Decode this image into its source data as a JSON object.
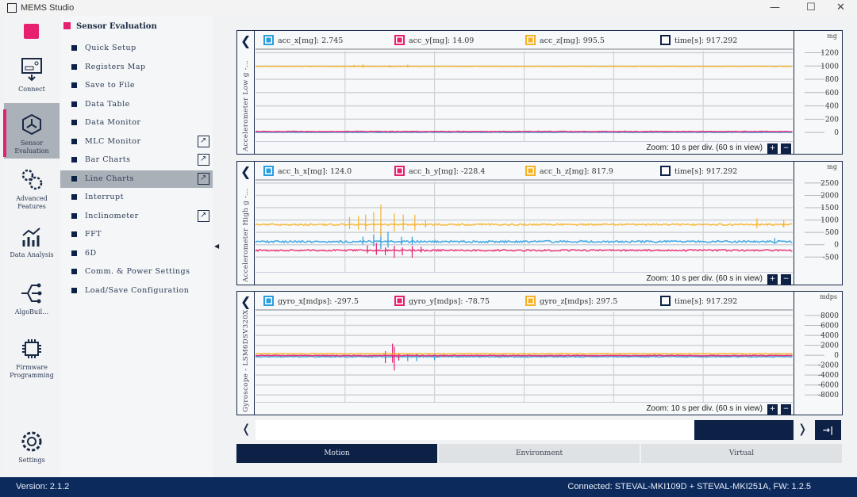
{
  "window": {
    "title": "MEMS Studio",
    "minimize": "—",
    "maximize": "☐",
    "close": "✕"
  },
  "rail": {
    "items": [
      {
        "label": "Connect",
        "icon": "connect-board-icon"
      },
      {
        "label": "Sensor Evaluation",
        "icon": "sensor-cube-icon",
        "selected": true
      },
      {
        "label": "Advanced Features",
        "icon": "gears-icon"
      },
      {
        "label": "Data Analysis",
        "icon": "analysis-chart-icon"
      },
      {
        "label": "AlgoBuil…",
        "icon": "algo-graph-icon"
      },
      {
        "label": "Firmware Programming",
        "icon": "chip-icon"
      },
      {
        "label": "Settings",
        "icon": "settings-gear-icon"
      }
    ]
  },
  "menu": {
    "header": "Sensor Evaluation",
    "items": [
      {
        "label": "Quick Setup"
      },
      {
        "label": "Registers Map"
      },
      {
        "label": "Save to File"
      },
      {
        "label": "Data Table"
      },
      {
        "label": "Data Monitor"
      },
      {
        "label": "MLC Monitor",
        "external": true
      },
      {
        "label": "Bar Charts",
        "external": true
      },
      {
        "label": "Line Charts",
        "external": true,
        "selected": true
      },
      {
        "label": "Interrupt"
      },
      {
        "label": "Inclinometer",
        "external": true
      },
      {
        "label": "FFT"
      },
      {
        "label": "6D"
      },
      {
        "label": "Comm. & Power Settings"
      },
      {
        "label": "Load/Save Configuration"
      }
    ],
    "collapse": "◀"
  },
  "colors": {
    "x": "#2a9de0",
    "y": "#e6206e",
    "z": "#f6b126",
    "time": "#0d2147",
    "accent": "#0d2147"
  },
  "chart_data": [
    {
      "type": "line",
      "title": "Accelerometer Low g -…",
      "unit": "mg",
      "ylim": [
        -130,
        1230
      ],
      "yticks": [
        0,
        200,
        400,
        600,
        800,
        1000,
        1200
      ],
      "xlim": [
        0,
        60
      ],
      "x_divisions": 6,
      "legend": [
        {
          "label": "acc_x[mg]: 2.745"
        },
        {
          "label": "acc_y[mg]: 14.09"
        },
        {
          "label": "acc_z[mg]: 995.5"
        },
        {
          "label": "time[s]: 917.292"
        }
      ],
      "series": [
        {
          "name": "acc_x",
          "color": "#2a9de0",
          "base": 3,
          "noise": 4,
          "spikes": [
            [
              15,
              -15
            ]
          ]
        },
        {
          "name": "acc_y",
          "color": "#e6206e",
          "base": 14,
          "noise": 4,
          "spikes": [
            [
              14.5,
              10
            ],
            [
              17,
              8
            ]
          ]
        },
        {
          "name": "acc_z",
          "color": "#f6b126",
          "base": 995,
          "noise": 3,
          "spikes": [
            [
              9,
              15
            ],
            [
              11,
              20
            ],
            [
              12,
              30
            ],
            [
              15,
              20
            ],
            [
              17,
              25
            ]
          ]
        }
      ],
      "zoom_text": "Zoom: 10 s per div. (60 s in view)"
    },
    {
      "type": "line",
      "title": "Accelerometer High g -…",
      "unit": "mg",
      "ylim": [
        -1100,
        2560
      ],
      "yticks": [
        -500,
        0,
        500,
        1000,
        1500,
        2000,
        2500
      ],
      "xlim": [
        0,
        60
      ],
      "x_divisions": 6,
      "legend": [
        {
          "label": "acc_h_x[mg]: 124.0"
        },
        {
          "label": "acc_h_y[mg]: -228.4"
        },
        {
          "label": "acc_h_z[mg]: 817.9"
        },
        {
          "label": "time[s]: 917.292"
        }
      ],
      "series": [
        {
          "name": "acc_h_x",
          "color": "#2a9de0",
          "base": 124,
          "noise": 40,
          "spikes": [
            [
              12,
              200
            ],
            [
              13.2,
              300
            ],
            [
              14,
              500
            ],
            [
              14.8,
              400
            ],
            [
              16.3,
              200
            ],
            [
              17.5,
              200
            ],
            [
              58,
              150
            ]
          ]
        },
        {
          "name": "acc_h_y",
          "color": "#e6206e",
          "base": -228,
          "noise": 30,
          "spikes": [
            [
              12.5,
              200
            ],
            [
              13.5,
              300
            ],
            [
              14.5,
              -200
            ],
            [
              15.5,
              -300
            ],
            [
              16.4,
              -200
            ],
            [
              17.5,
              -300
            ],
            [
              18.5,
              150
            ]
          ]
        },
        {
          "name": "acc_h_z",
          "color": "#f6b126",
          "base": 818,
          "noise": 30,
          "spikes": [
            [
              10.5,
              300
            ],
            [
              11.5,
              350
            ],
            [
              12.3,
              400
            ],
            [
              13.2,
              500
            ],
            [
              14,
              800
            ],
            [
              15.5,
              450
            ],
            [
              16.5,
              400
            ],
            [
              17.8,
              400
            ],
            [
              19,
              200
            ],
            [
              56,
              250
            ],
            [
              59,
              200
            ]
          ]
        }
      ],
      "zoom_text": "Zoom: 10 s per div. (60 s in view)"
    },
    {
      "type": "line",
      "title": "Gyroscope - LSM6DSV320X",
      "unit": "mdps",
      "ylim": [
        -9400,
        8800
      ],
      "yticks": [
        -8000,
        -6000,
        -4000,
        -2000,
        0,
        2000,
        4000,
        6000,
        8000
      ],
      "xlim": [
        0,
        60
      ],
      "x_divisions": 6,
      "legend": [
        {
          "label": "gyro_x[mdps]: -297.5"
        },
        {
          "label": "gyro_y[mdps]: -78.75"
        },
        {
          "label": "gyro_z[mdps]: 297.5"
        },
        {
          "label": "time[s]: 917.292"
        }
      ],
      "series": [
        {
          "name": "gyro_x",
          "color": "#2a9de0",
          "base": -300,
          "noise": 80,
          "spikes": [
            [
              16,
              -800
            ],
            [
              17,
              -900
            ],
            [
              18,
              -900
            ],
            [
              20,
              -700
            ]
          ]
        },
        {
          "name": "gyro_y",
          "color": "#e6206e",
          "base": -80,
          "noise": 80,
          "spikes": [
            [
              14.5,
              -1500
            ],
            [
              15.3,
              2400
            ],
            [
              15.5,
              -3000
            ],
            [
              16,
              -900
            ],
            [
              21,
              400
            ]
          ]
        },
        {
          "name": "gyro_z",
          "color": "#f6b126",
          "base": 300,
          "noise": 60,
          "spikes": []
        }
      ],
      "zoom_text": "Zoom: 10 s per div. (60 s in view)"
    }
  ],
  "zoom_in": "+",
  "zoom_out": "−",
  "nav": {
    "prev": "❬",
    "next": "❭",
    "end": "→|"
  },
  "tabs": [
    {
      "label": "Motion",
      "selected": true
    },
    {
      "label": "Environment"
    },
    {
      "label": "Virtual"
    }
  ],
  "status": {
    "version": "Version: 2.1.2",
    "connected": "Connected:  STEVAL-MKI109D + STEVAL-MKI251A, FW: 1.2.5"
  }
}
